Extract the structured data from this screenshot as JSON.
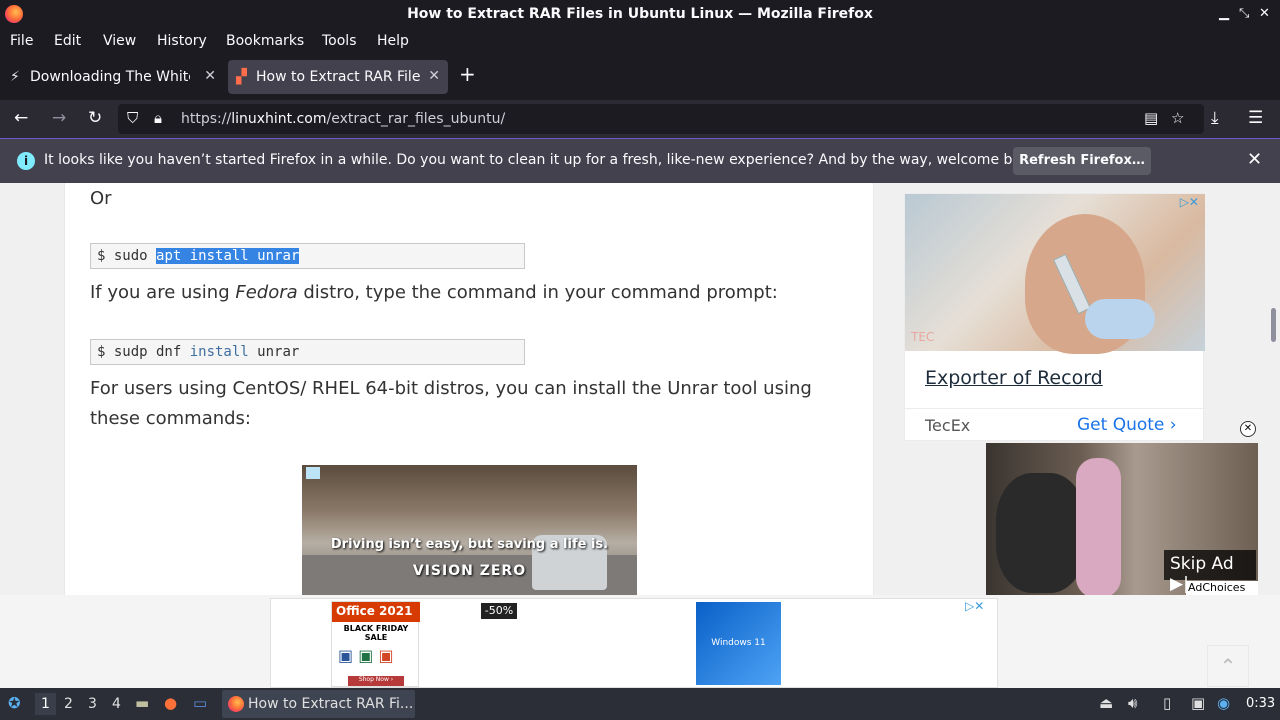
{
  "window": {
    "title": "How to Extract RAR Files in Ubuntu Linux — Mozilla Firefox"
  },
  "menu": [
    "File",
    "Edit",
    "View",
    "History",
    "Bookmarks",
    "Tools",
    "Help"
  ],
  "tabs": [
    {
      "label": "Downloading The White H",
      "active": false
    },
    {
      "label": "How to Extract RAR Files i",
      "active": true
    }
  ],
  "nav": {
    "url_prefix": "https://",
    "url_host": "linuxhint.com",
    "url_path": "/extract_rar_files_ubuntu/"
  },
  "notification": {
    "message": "It looks like you haven’t started Firefox in a while. Do you want to clean it up for a fresh, like-new experience? And by the way, welcome back!",
    "button": "Refresh Firefox…"
  },
  "article": {
    "or": "Or",
    "cmd1": {
      "prompt": "$ sudo ",
      "selected": "apt install unrar"
    },
    "fedora_pre": "If you are using ",
    "fedora_em": "Fedora",
    "fedora_post": " distro, type the command in your command prompt:",
    "cmd2": {
      "p1": "$ sudp dnf ",
      "kw": "install",
      "p2": " unrar"
    },
    "centos": "For users using CentOS/ RHEL 64-bit distros, you can install the Unrar tool using these commands:"
  },
  "video_ad": {
    "caption": "Driving isn’t easy, but saving a life is.",
    "brand": "VISION ZERO"
  },
  "side_ad": {
    "logo": "TEC",
    "heading": "Exporter of Record",
    "brand": "TecEx",
    "cta": "Get Quote ›"
  },
  "pip_ad": {
    "skip": "Skip Ad ▶|",
    "adchoices": "AdChoices"
  },
  "bottom_ad": {
    "office_title": "Office 2021",
    "office_sub": "BLACK FRIDAY SALE",
    "shop": "Shop Now ›",
    "discount": "-50%",
    "windows": "Windows 11"
  },
  "taskbar": {
    "workspaces": [
      "1",
      "2",
      "3",
      "4"
    ],
    "task_label": "How to Extract RAR Fi...",
    "clock": "0:33"
  }
}
